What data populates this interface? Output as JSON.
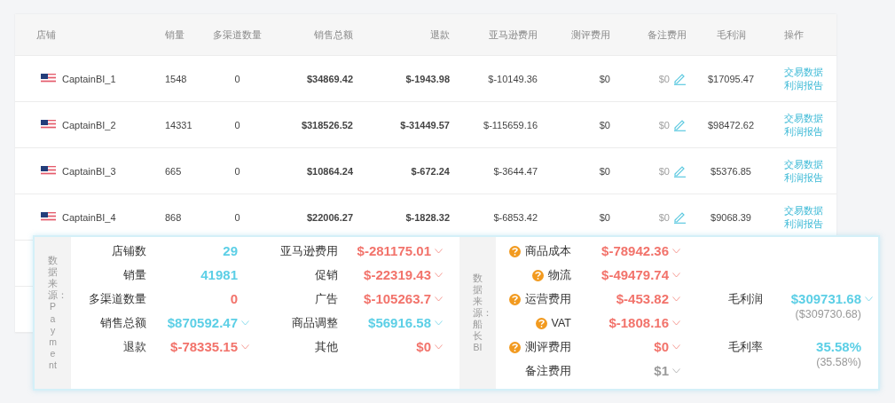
{
  "table": {
    "columns": [
      "店铺",
      "销量",
      "多渠道数量",
      "销售总额",
      "退款",
      "亚马逊费用",
      "测评费用",
      "备注费用",
      "毛利润",
      "操作"
    ],
    "rows": [
      {
        "store": "CaptainBI_1",
        "sales": "1548",
        "multichannel": "0",
        "total": "$34869.42",
        "refund": "$-1943.98",
        "amazon_fee": "$-10149.36",
        "review_fee": "$0",
        "note_fee": "$0",
        "gross_profit": "$17095.47",
        "actions": [
          "交易数据",
          "利润报告"
        ]
      },
      {
        "store": "CaptainBI_2",
        "sales": "14331",
        "multichannel": "0",
        "total": "$318526.52",
        "refund": "$-31449.57",
        "amazon_fee": "$-115659.16",
        "review_fee": "$0",
        "note_fee": "$0",
        "gross_profit": "$98472.62",
        "actions": [
          "交易数据",
          "利润报告"
        ]
      },
      {
        "store": "CaptainBI_3",
        "sales": "665",
        "multichannel": "0",
        "total": "$10864.24",
        "refund": "$-672.24",
        "amazon_fee": "$-3644.47",
        "review_fee": "$0",
        "note_fee": "$0",
        "gross_profit": "$5376.85",
        "actions": [
          "交易数据",
          "利润报告"
        ]
      },
      {
        "store": "CaptainBI_4",
        "sales": "868",
        "multichannel": "0",
        "total": "$22006.27",
        "refund": "$-1828.32",
        "amazon_fee": "$-6853.42",
        "review_fee": "$0",
        "note_fee": "$0",
        "gross_profit": "$9068.39",
        "actions": [
          "交易数据",
          "利润报告"
        ]
      }
    ]
  },
  "summary": {
    "panels": [
      {
        "source_label": "数据来源：Payment",
        "columns": [
          {
            "kind": "list",
            "items": [
              {
                "label": "店铺数",
                "value": "29",
                "color": "#5ccfe6",
                "dropdown": false,
                "help": false
              },
              {
                "label": "销量",
                "value": "41981",
                "color": "#5ccfe6",
                "dropdown": false,
                "help": false
              },
              {
                "label": "多渠道数量",
                "value": "0",
                "color": "#f2736b",
                "dropdown": false,
                "help": false
              },
              {
                "label": "销售总额",
                "value": "$870592.47",
                "color": "#5ccfe6",
                "dropdown": true,
                "help": false
              },
              {
                "label": "退款",
                "value": "$-78335.15",
                "color": "#f2736b",
                "dropdown": true,
                "help": false
              }
            ]
          },
          {
            "kind": "list",
            "items": [
              {
                "label": "亚马逊费用",
                "value": "$-281175.01",
                "color": "#f2736b",
                "dropdown": true,
                "help": false
              },
              {
                "label": "促销",
                "value": "$-22319.43",
                "color": "#f2736b",
                "dropdown": true,
                "help": false
              },
              {
                "label": "广告",
                "value": "$-105263.7",
                "color": "#f2736b",
                "dropdown": true,
                "help": false
              },
              {
                "label": "商品调整",
                "value": "$56916.58",
                "color": "#5ccfe6",
                "dropdown": true,
                "help": false
              },
              {
                "label": "其他",
                "value": "$0",
                "color": "#f2736b",
                "dropdown": true,
                "help": false
              }
            ]
          }
        ]
      },
      {
        "source_label": "数据来源：船长BI",
        "columns": [
          {
            "kind": "list",
            "items": [
              {
                "label": "商品成本",
                "value": "$-78942.36",
                "color": "#f2736b",
                "dropdown": true,
                "help": true
              },
              {
                "label": "物流",
                "value": "$-49479.74",
                "color": "#f2736b",
                "dropdown": true,
                "help": true
              },
              {
                "label": "运营费用",
                "value": "$-453.82",
                "color": "#f2736b",
                "dropdown": true,
                "help": true
              },
              {
                "label": "VAT",
                "value": "$-1808.16",
                "color": "#f2736b",
                "dropdown": true,
                "help": true
              },
              {
                "label": "测评费用",
                "value": "$0",
                "color": "#f2736b",
                "dropdown": true,
                "help": true
              },
              {
                "label": "备注费用",
                "value": "$1",
                "color": "#9a9a9a",
                "dropdown": true,
                "help": false
              }
            ]
          },
          {
            "kind": "totals",
            "items": [
              {
                "label": "毛利润",
                "value": "$309731.68",
                "sub": "($309730.68)",
                "color": "#5ccfe6",
                "dropdown": true,
                "help": false
              },
              {
                "label": "毛利率",
                "value": "35.58%",
                "sub": "(35.58%)",
                "color": "#5ccfe6",
                "dropdown": false,
                "help": false
              }
            ]
          }
        ]
      }
    ]
  }
}
